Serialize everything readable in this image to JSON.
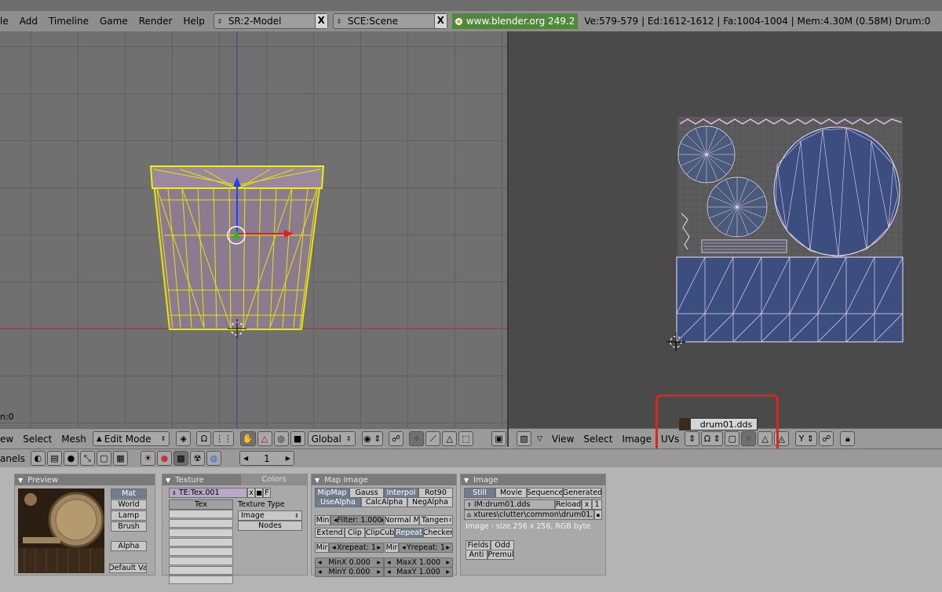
{
  "top": {
    "menus": [
      "le",
      "Add",
      "Timeline",
      "Game",
      "Render",
      "Help"
    ],
    "screen_selector": "SR:2-Model",
    "scene_selector": "SCE:Scene",
    "website": "www.blender.org 249.2",
    "stats": "Ve:579-579 | Ed:1612-1612 | Fa:1004-1004 | Mem:4.30M (0.58M) Drum:0",
    "close_x": "X"
  },
  "view3d": {
    "frame_label": "n:0",
    "header": {
      "menus": [
        "ew",
        "Select",
        "Mesh"
      ],
      "mode": "Edit Mode",
      "orientation": "Global"
    }
  },
  "uv": {
    "header": {
      "menus": [
        "View",
        "Select",
        "Image",
        "UVs"
      ]
    },
    "popup": "drum01.dds"
  },
  "buttons_header": {
    "label": "anels",
    "frame": "1"
  },
  "panels": {
    "preview": {
      "title": "Preview",
      "buttons": [
        "Mat",
        "World",
        "Lamp",
        "Brush"
      ],
      "alpha": "Alpha",
      "default": "Default Va"
    },
    "texture": {
      "title": "Texture",
      "tab2": "Colors",
      "tex_name": "TE:Tex.001",
      "f_btn": "F",
      "tex_slot": "Tex",
      "type_label": "Texture Type",
      "type_value": "Image",
      "nodes": "Nodes"
    },
    "map_image": {
      "title": "Map Image",
      "row1": [
        "MipMap",
        "Gauss",
        "Interpol",
        "Rot90"
      ],
      "row2": [
        "UseAlpha",
        "CalcAlpha",
        "NegAlpha"
      ],
      "min": "Min",
      "filter": "Filter: 1.000",
      "normal": "Normal M",
      "tangent": "Tangen",
      "row4": [
        "Extend",
        "Clip",
        "ClipCub",
        "Repeat",
        "Checker"
      ],
      "mir": "Mir",
      "xrepeat": "Xrepeat: 1",
      "mir2": "Mir",
      "yrepeat": "Yrepeat: 1",
      "minx": "MinX 0.000",
      "maxx": "MaxX 1.000",
      "miny": "MinY 0.000",
      "maxy": "MaxY 1.000"
    },
    "image": {
      "title": "Image",
      "sources": [
        "Still",
        "Movie",
        "Sequence",
        "Generated"
      ],
      "im_name": "IM:drum01.dds",
      "reload": "Reload",
      "x": "x",
      "one": "1",
      "path": "xtures\\clutter\\common\\drum01.dds",
      "info": "Image : size 256 x 256, RGB byte",
      "fields": "Fields",
      "odd": "Odd",
      "anti": "Anti",
      "premul": "Premul"
    }
  }
}
